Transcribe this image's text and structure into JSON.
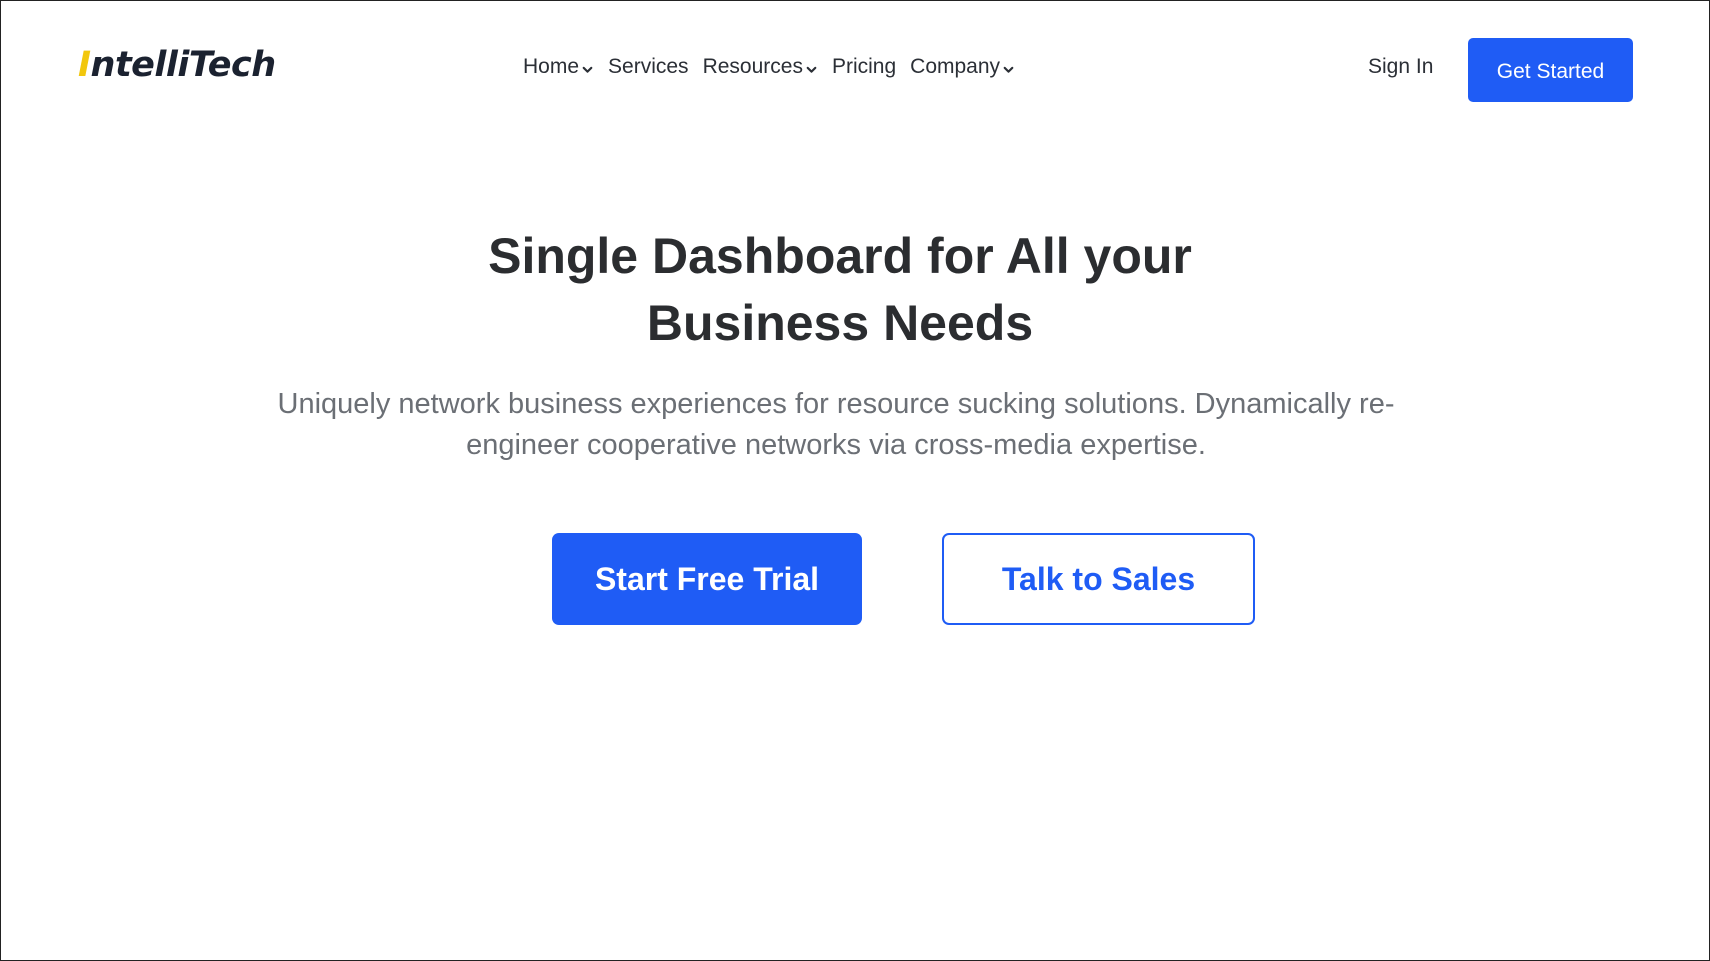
{
  "brand": {
    "logo_accent": "I",
    "logo_rest": "ntelliTech",
    "accent_color": "#f2c70d",
    "primary_color": "#1f5cf5"
  },
  "nav": {
    "items": [
      {
        "label": "Home",
        "has_dropdown": true
      },
      {
        "label": "Services",
        "has_dropdown": false
      },
      {
        "label": "Resources",
        "has_dropdown": true
      },
      {
        "label": "Pricing",
        "has_dropdown": false
      },
      {
        "label": "Company",
        "has_dropdown": true
      }
    ],
    "dropdown_icon": "chevron-down-icon"
  },
  "header": {
    "sign_in_label": "Sign In",
    "get_started_label": "Get Started"
  },
  "hero": {
    "title_line1": "Single Dashboard for All your",
    "title_line2": "Business Needs",
    "subtitle": "Uniquely network business experiences for resource sucking solutions. Dynamically re-engineer cooperative networks via cross-media expertise.",
    "primary_cta": "Start Free Trial",
    "secondary_cta": "Talk to Sales"
  }
}
